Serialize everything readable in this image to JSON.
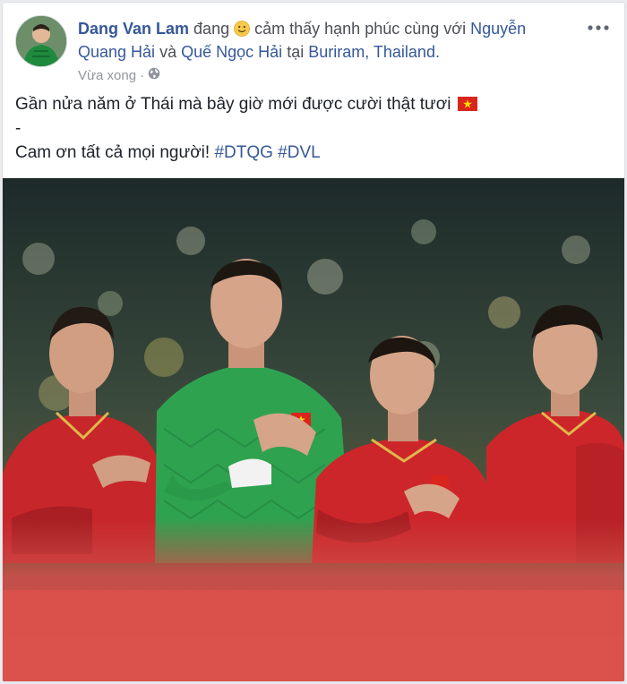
{
  "post": {
    "author": "Dang Van Lam",
    "verb": "đang",
    "feeling": "cảm thấy hạnh phúc",
    "with_word": "cùng với",
    "tagged_1": "Nguyễn Quang Hải",
    "and_word": "và",
    "tagged_2": "Quế Ngọc Hải",
    "at_word": "tại",
    "location": "Buriram, Thailand.",
    "timestamp": "Vừa xong",
    "audience_icon": "globe-icon",
    "menu_icon": "more-options-icon",
    "line1": "Gần nửa năm ở Thái mà bây giờ mới được cười thật tươi",
    "line2": "-",
    "line3_text": "Cam ơn tất cả mọi người!",
    "hashtag_1": "#DTQG",
    "hashtag_2": "#DVL"
  },
  "colors": {
    "link": "#365899",
    "text": "#1d2129",
    "meta": "#90949c",
    "flag_red": "#da251d",
    "flag_star": "#ffde00"
  }
}
